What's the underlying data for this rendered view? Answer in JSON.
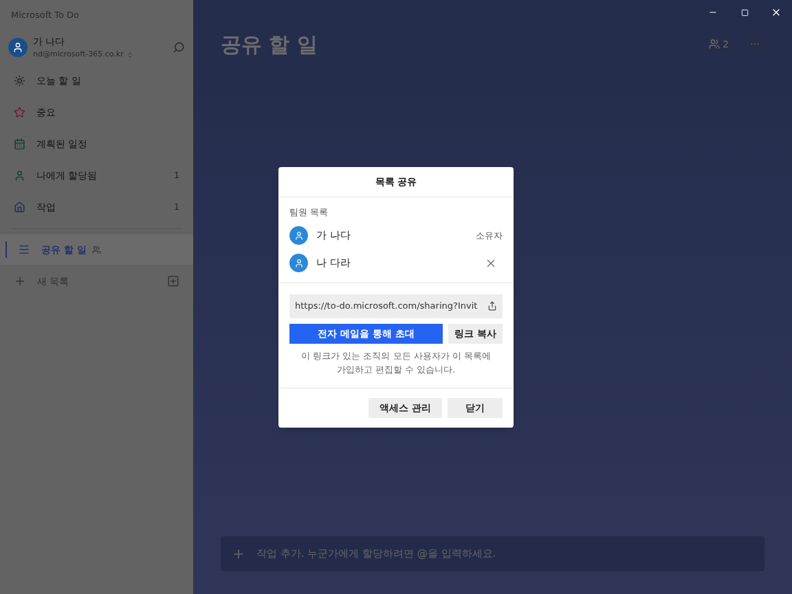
{
  "window": {
    "title": "Microsoft To Do"
  },
  "account": {
    "name": "가 나다",
    "email": "nd@microsoft-365.co.kr"
  },
  "sidebar": {
    "items": [
      {
        "kind": "sun",
        "label": "오늘 할 일"
      },
      {
        "kind": "star",
        "label": "중요"
      },
      {
        "kind": "calendar",
        "label": "계획된 일정"
      },
      {
        "kind": "person",
        "label": "나에게 할당됨",
        "count": "1"
      },
      {
        "kind": "home",
        "label": "작업",
        "count": "1"
      }
    ],
    "lists": [
      {
        "label": "공유 할 일",
        "shared": true,
        "selected": true
      }
    ],
    "new_list": "새 목록"
  },
  "main": {
    "title": "공유 할 일",
    "member_count": "2",
    "more": "···",
    "add_task_placeholder": "작업 추가. 누군가에게 할당하려면 @을 입력하세요."
  },
  "dialog": {
    "title": "목록 공유",
    "members_heading": "팀원 목록",
    "members": [
      {
        "name": "가 나다",
        "kind": "owner",
        "role": "소유자"
      },
      {
        "name": "나 다라",
        "kind": "removable"
      }
    ],
    "link": "https://to-do.microsoft.com/sharing?Invit",
    "invite_button": "전자 메일을 통해 초대",
    "copy_button": "링크 복사",
    "note": "이 링크가 있는 조직의 모든 사용자가 이 목록에 가입하고 편집할 수 있습니다.",
    "buttons": [
      "액세스 관리",
      "닫기"
    ]
  }
}
